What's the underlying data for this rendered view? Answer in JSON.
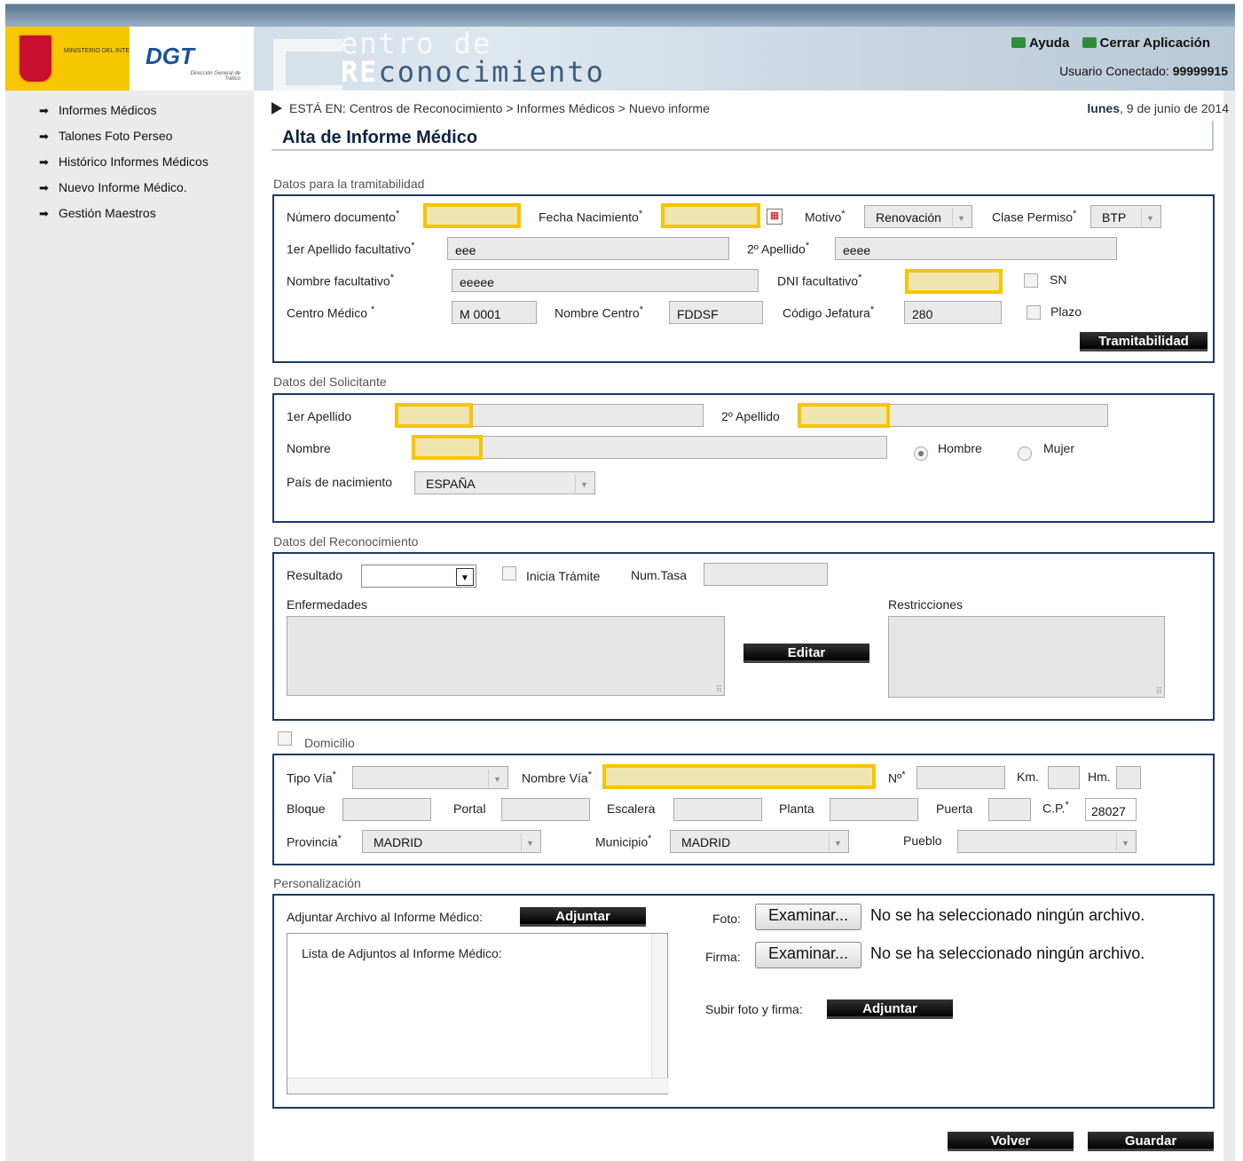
{
  "header": {
    "ministerio": "MINISTERIO DEL INTERIOR",
    "dgt": "DGT",
    "dgt_sub": "Dirección General de Tráfico",
    "title_line1": "entro de",
    "title_line2_re": "RE",
    "title_line2_rest": "conocimiento",
    "help_label": "Ayuda",
    "close_label": "Cerrar Aplicación",
    "user_label": "Usuario Conectado:",
    "user_id": "99999915"
  },
  "sidebar": {
    "items": [
      {
        "label": "Informes Médicos"
      },
      {
        "label": "Talones Foto Perseo"
      },
      {
        "label": "Histórico Informes Médicos"
      },
      {
        "label": "Nuevo Informe Médico."
      },
      {
        "label": "Gestión Maestros"
      }
    ]
  },
  "breadcrumb": {
    "prefix": "ESTÁ EN:",
    "path": "Centros de Reconocimiento > Informes Médicos > Nuevo informe"
  },
  "date": {
    "weekday": "lunes",
    "rest": ", 9 de junio de 2014"
  },
  "page_title": "Alta de Informe Médico",
  "tramitabilidad": {
    "section_label": "Datos para la tramitabilidad",
    "num_doc_label": "Número documento",
    "fecha_nac_label": "Fecha Nacimiento",
    "motivo_label": "Motivo",
    "motivo_value": "Renovación",
    "clase_label": "Clase Permiso",
    "clase_value": "BTP",
    "apellido1_label": "1er Apellido facultativo",
    "apellido1_value": "eee",
    "apellido2_label": "2º Apellido",
    "apellido2_value": "eeee",
    "nombre_label": "Nombre facultativo",
    "nombre_value": "eeeee",
    "dni_label": "DNI facultativo",
    "sn_label": "SN",
    "centro_label": "Centro Médico",
    "centro_value": "M 0001",
    "nombre_centro_label": "Nombre Centro",
    "nombre_centro_value": "FDDSF",
    "jefatura_label": "Código Jefatura",
    "jefatura_value": "280",
    "plazo_label": "Plazo",
    "button": "Tramitabilidad",
    "asterisk": "*"
  },
  "solicitante": {
    "section_label": "Datos del Solicitante",
    "apellido1_label": "1er Apellido",
    "apellido2_label": "2º Apellido",
    "nombre_label": "Nombre",
    "hombre_label": "Hombre",
    "mujer_label": "Mujer",
    "pais_label": "País de nacimiento",
    "pais_value": "ESPAÑA"
  },
  "reconocimiento": {
    "section_label": "Datos del Reconocimiento",
    "resultado_label": "Resultado",
    "inicia_label": "Inicia Trámite",
    "numtasa_label": "Num.Tasa",
    "enfermedades_label": "Enfermedades",
    "restricciones_label": "Restricciones",
    "editar_button": "Editar"
  },
  "domicilio": {
    "section_label": "Domicilio",
    "tipo_via_label": "Tipo Vía",
    "nombre_via_label": "Nombre Vía",
    "num_label": "Nº",
    "km_label": "Km.",
    "hm_label": "Hm.",
    "bloque_label": "Bloque",
    "portal_label": "Portal",
    "escalera_label": "Escalera",
    "planta_label": "Planta",
    "puerta_label": "Puerta",
    "cp_label": "C.P.",
    "cp_value": "28027",
    "provincia_label": "Provincia",
    "provincia_value": "MADRID",
    "municipio_label": "Municipio",
    "municipio_value": "MADRID",
    "pueblo_label": "Pueblo"
  },
  "personalizacion": {
    "section_label": "Personalización",
    "adjuntar_label": "Adjuntar Archivo al Informe Médico:",
    "adjuntar_button": "Adjuntar",
    "lista_label": "Lista de Adjuntos al Informe Médico:",
    "foto_label": "Foto:",
    "firma_label": "Firma:",
    "examinar_button": "Examinar...",
    "no_file_text": "No se ha seleccionado ningún archivo.",
    "subir_label": "Subir foto y firma:",
    "subir_button": "Adjuntar"
  },
  "footer": {
    "volver_button": "Volver",
    "guardar_button": "Guardar"
  }
}
